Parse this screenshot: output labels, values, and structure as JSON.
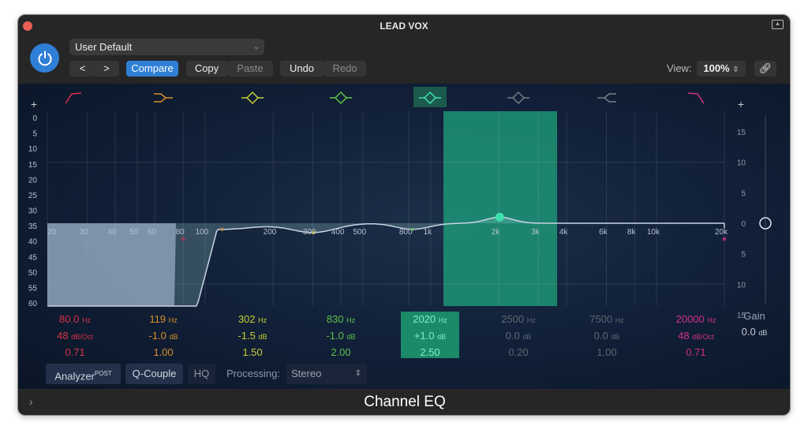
{
  "window": {
    "title": "LEAD VOX",
    "footer_title": "Channel EQ"
  },
  "toolbar": {
    "preset": "User Default",
    "prev": "<",
    "next": ">",
    "compare": "Compare",
    "copy": "Copy",
    "paste": "Paste",
    "undo": "Undo",
    "redo": "Redo",
    "view_label": "View:",
    "view_value": "100%"
  },
  "colors": {
    "accent": "#2f7fd6",
    "selected_band": "#1fa37e"
  },
  "graph": {
    "freq_ticks": [
      "20",
      "30",
      "40",
      "50",
      "60",
      "80",
      "100",
      "200",
      "300",
      "400",
      "500",
      "800",
      "1k",
      "2k",
      "3k",
      "4k",
      "6k",
      "8k",
      "10k",
      "20k"
    ],
    "freq_values": [
      20,
      30,
      40,
      50,
      60,
      80,
      100,
      200,
      300,
      400,
      500,
      800,
      1000,
      2000,
      3000,
      4000,
      6000,
      8000,
      10000,
      20000
    ],
    "analyzer_scale": [
      "0",
      "5",
      "10",
      "15",
      "20",
      "25",
      "30",
      "35",
      "40",
      "45",
      "50",
      "55",
      "60"
    ],
    "gain_scale": [
      "15",
      "10",
      "5",
      "0",
      "5",
      "10",
      "15"
    ],
    "plus": "+"
  },
  "bands": [
    {
      "type": "low-cut",
      "freq": "80.0",
      "freq_unit": "Hz",
      "gain": "48",
      "gain_unit": "dB/Oct",
      "q": "0.71",
      "color": "#d8324a",
      "enabled": true,
      "f": 80,
      "g": 0,
      "qv": 0.71
    },
    {
      "type": "low-shelf",
      "freq": "119",
      "freq_unit": "Hz",
      "gain": "-1.0",
      "gain_unit": "dB",
      "q": "1.00",
      "color": "#d98f2b",
      "enabled": true,
      "f": 119,
      "g": -1,
      "qv": 1
    },
    {
      "type": "bell",
      "freq": "302",
      "freq_unit": "Hz",
      "gain": "-1.5",
      "gain_unit": "dB",
      "q": "1.50",
      "color": "#c7cf36",
      "enabled": true,
      "f": 302,
      "g": -1.5,
      "qv": 1.5
    },
    {
      "type": "bell",
      "freq": "830",
      "freq_unit": "Hz",
      "gain": "-1.0",
      "gain_unit": "dB",
      "q": "2.00",
      "color": "#5cc24a",
      "enabled": true,
      "f": 830,
      "g": -1,
      "qv": 2
    },
    {
      "type": "bell",
      "freq": "2020",
      "freq_unit": "Hz",
      "gain": "+1.0",
      "gain_unit": "dB",
      "q": "2.50",
      "color": "#3fe0b0",
      "enabled": true,
      "selected": true,
      "f": 2020,
      "g": 1,
      "qv": 2.5
    },
    {
      "type": "bell",
      "freq": "2500",
      "freq_unit": "Hz",
      "gain": "0.0",
      "gain_unit": "dB",
      "q": "0.20",
      "color": "#777d86",
      "enabled": false,
      "f": 2500,
      "g": 0,
      "qv": 0.2
    },
    {
      "type": "high-shelf",
      "freq": "7500",
      "freq_unit": "Hz",
      "gain": "0.0",
      "gain_unit": "dB",
      "q": "1.00",
      "color": "#777d86",
      "enabled": false,
      "f": 7500,
      "g": 0,
      "qv": 1
    },
    {
      "type": "high-cut",
      "freq": "20000",
      "freq_unit": "Hz",
      "gain": "48",
      "gain_unit": "dB/Oct",
      "q": "0.71",
      "color": "#d12f86",
      "enabled": true,
      "f": 20000,
      "g": 0,
      "qv": 0.71
    }
  ],
  "output": {
    "label": "Gain",
    "value": "0.0",
    "unit": "dB",
    "gain": 0
  },
  "bottom": {
    "analyzer": "Analyzer",
    "analyzer_sup": "POST",
    "q_couple": "Q-Couple",
    "hq": "HQ",
    "processing_label": "Processing:",
    "processing_value": "Stereo"
  }
}
